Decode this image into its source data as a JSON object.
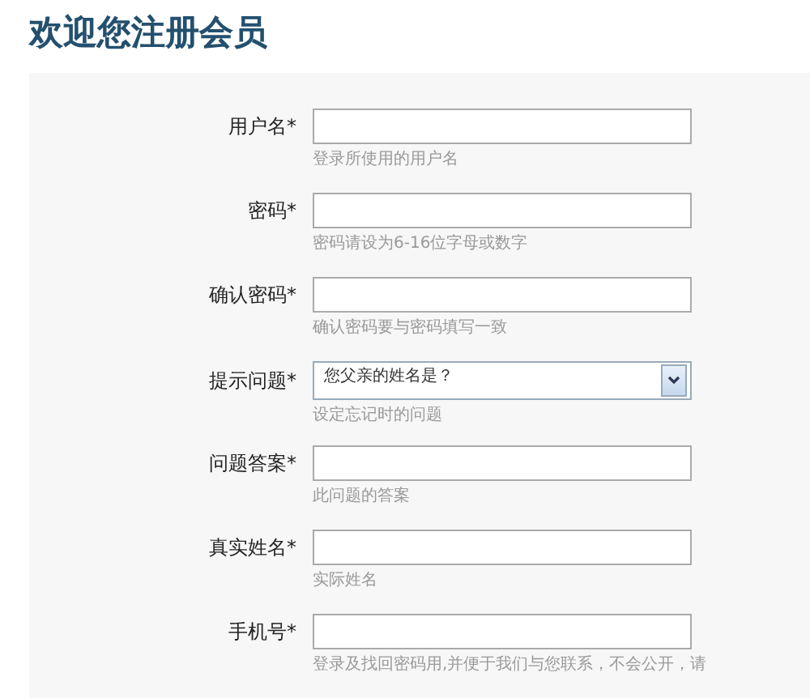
{
  "title": "欢迎您注册会员",
  "fields": [
    {
      "kind": "text",
      "label": "用户名*",
      "hint": "登录所使用的用户名"
    },
    {
      "kind": "text",
      "label": "密码*",
      "hint": "密码请设为6-16位字母或数字"
    },
    {
      "kind": "text",
      "label": "确认密码*",
      "hint": "确认密码要与密码填写一致"
    },
    {
      "kind": "select",
      "label": "提示问题*",
      "value": "您父亲的姓名是？",
      "hint": "设定忘记时的问题"
    },
    {
      "kind": "text",
      "label": "问题答案*",
      "hint": "此问题的答案"
    },
    {
      "kind": "text",
      "label": "真实姓名*",
      "hint": "实际姓名"
    },
    {
      "kind": "text",
      "label": "手机号*",
      "hint": "登录及找回密码用,并便于我们与您联系，不会公开，请"
    }
  ]
}
